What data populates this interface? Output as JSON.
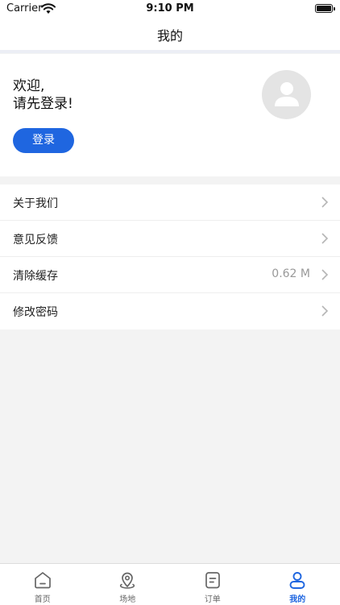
{
  "status_bar": {
    "carrier": "Carrier",
    "time": "9:10 PM"
  },
  "nav": {
    "title": "我的"
  },
  "profile": {
    "greeting_line1": "欢迎,",
    "greeting_line2": "请先登录!",
    "login_label": "登录"
  },
  "menu": {
    "items": [
      {
        "label": "关于我们",
        "value": ""
      },
      {
        "label": "意见反馈",
        "value": ""
      },
      {
        "label": "清除缓存",
        "value": "0.62 M"
      },
      {
        "label": "修改密码",
        "value": ""
      }
    ]
  },
  "tabbar": {
    "items": [
      {
        "label": "首页",
        "icon": "home-icon"
      },
      {
        "label": "场地",
        "icon": "location-pin-icon"
      },
      {
        "label": "订单",
        "icon": "order-document-icon"
      },
      {
        "label": "我的",
        "icon": "user-icon"
      }
    ],
    "active_color": "#1f66e0",
    "inactive_color": "#666666"
  },
  "colors": {
    "accent": "#1f66e0",
    "background": "#f3f3f3"
  }
}
